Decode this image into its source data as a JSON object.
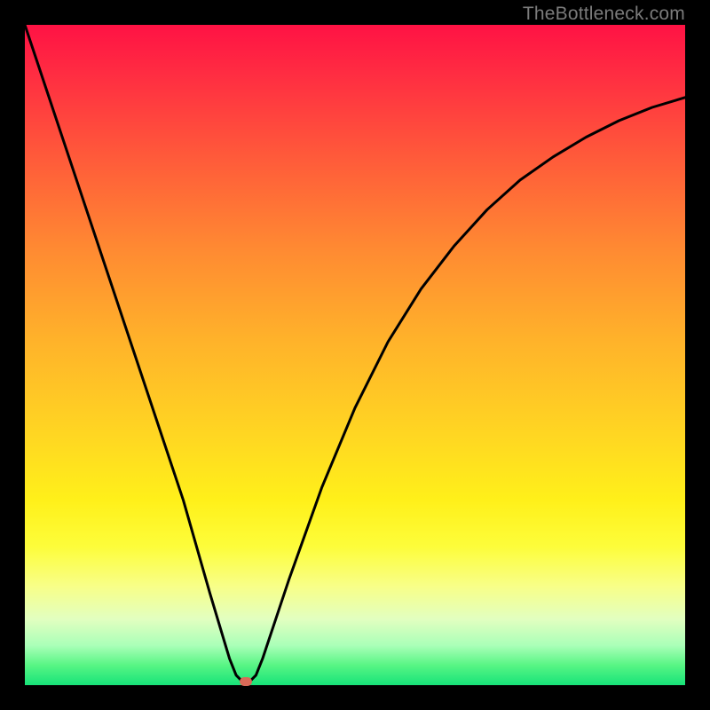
{
  "watermark": "TheBottleneck.com",
  "colors": {
    "curve": "#000000",
    "marker": "#d96a58",
    "frame": "#000000"
  },
  "chart_data": {
    "type": "line",
    "title": "",
    "xlabel": "",
    "ylabel": "",
    "xlim": [
      0,
      100
    ],
    "ylim": [
      0,
      100
    ],
    "grid": false,
    "annotations": [
      {
        "text": "TheBottleneck.com",
        "position": "top-right"
      }
    ],
    "marker": {
      "x": 33.5,
      "y": 0.5
    },
    "series": [
      {
        "name": "bottleneck-curve",
        "x": [
          0,
          4,
          8,
          12,
          16,
          20,
          24,
          28,
          31,
          32,
          33,
          34,
          35,
          36,
          40,
          45,
          50,
          55,
          60,
          65,
          70,
          75,
          80,
          85,
          90,
          95,
          100
        ],
        "values": [
          100,
          88,
          76,
          64,
          52,
          40,
          28,
          14,
          4,
          1.5,
          0.5,
          0.5,
          1.5,
          4,
          16,
          30,
          42,
          52,
          60,
          66.5,
          72,
          76.5,
          80,
          83,
          85.5,
          87.5,
          89
        ]
      }
    ],
    "notes": "Curve values estimated from pixel positions; x is horizontal 0-100 left→right, values are vertical 0 (bottom) → 100 (top). Minimum ≈ x=33.5."
  }
}
